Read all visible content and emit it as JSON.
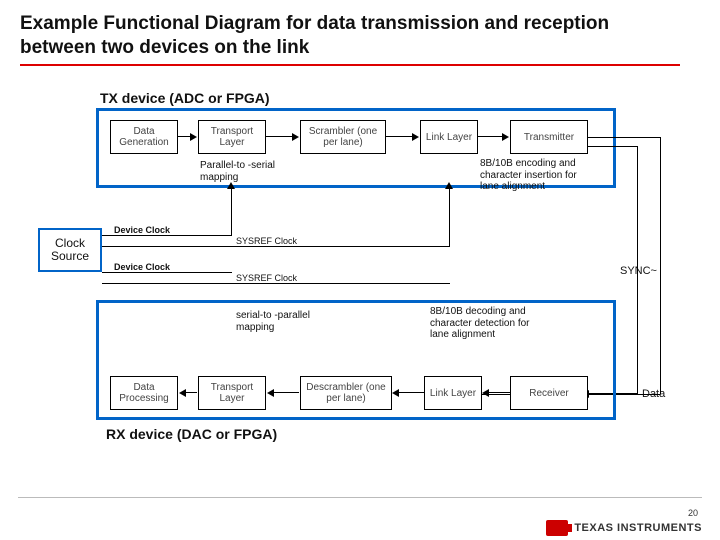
{
  "title": "Example Functional Diagram for data transmission and reception between two devices on the link",
  "tx": {
    "label": "TX device (ADC or FPGA)",
    "blocks": {
      "datagen": "Data Generation",
      "transport": "Transport Layer",
      "scrambler": "Scrambler (one per lane)",
      "link": "Link Layer",
      "transmitter": "Transmitter"
    },
    "notes": {
      "mapping": "Parallel-to -serial mapping",
      "encoding": "8B/10B encoding and character insertion for lane alignment"
    }
  },
  "rx": {
    "label": "RX device (DAC or FPGA)",
    "blocks": {
      "dataproc": "Data Processing",
      "transport": "Transport Layer",
      "descrambler": "Descrambler (one per lane)",
      "link": "Link Layer",
      "receiver": "Receiver"
    },
    "notes": {
      "mapping": "serial-to -parallel mapping",
      "decoding": "8B/10B decoding and character detection for lane alignment"
    }
  },
  "clock": {
    "source": "Clock Source",
    "device": "Device Clock",
    "sysref": "SYSREF Clock"
  },
  "signals": {
    "sync": "SYNC~",
    "data": "Data"
  },
  "footer": {
    "brand": "TEXAS INSTRUMENTS",
    "page": "20"
  }
}
